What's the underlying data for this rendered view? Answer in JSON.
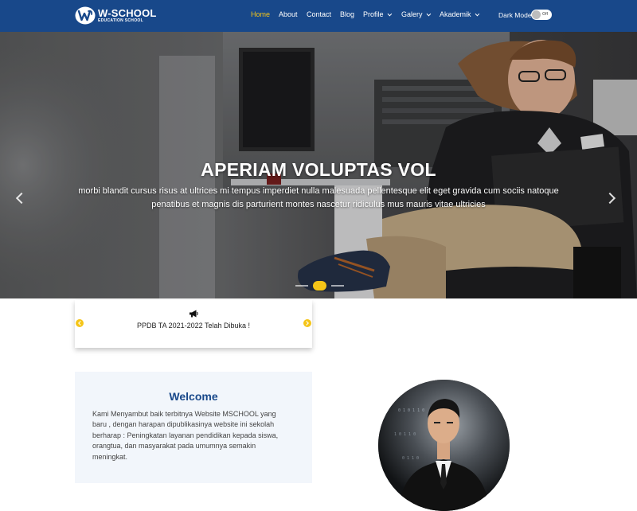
{
  "brand": {
    "name": "W-SCHOOL",
    "subtitle": "EDUCATION SCHOOL",
    "logo_letter": "W"
  },
  "nav": {
    "items": [
      {
        "label": "Home",
        "active": true
      },
      {
        "label": "About"
      },
      {
        "label": "Contact"
      },
      {
        "label": "Blog"
      },
      {
        "label": "Profile",
        "dropdown": true
      },
      {
        "label": "Galery",
        "dropdown": true
      },
      {
        "label": "Akademik",
        "dropdown": true
      }
    ],
    "dark_mode_label": "Dark Mode",
    "dark_mode_toggle_state": "Off"
  },
  "hero": {
    "title": "APERIAM VOLUPTAS VOL",
    "description": "morbi blandit cursus risus at ultrices mi tempus imperdiet nulla malesuada pellentesque elit eget gravida cum sociis natoque penatibus et magnis dis parturient montes nascetur ridiculus mus mauris vitae ultricies",
    "slide_count": 3,
    "active_slide": 2
  },
  "announcement": {
    "icon": "megaphone-icon",
    "text": "PPDB TA 2021-2022 Telah Dibuka !"
  },
  "welcome": {
    "title": "Welcome",
    "text": "Kami Menyambut baik terbitnya Website MSCHOOL yang baru , dengan harapan dipublikasinya website ini sekolah berharap : Peningkatan layanan pendidikan kepada siswa, orangtua, dan masyarakat pada umumnya semakin meningkat."
  },
  "colors": {
    "navbar": "#18488a",
    "accent": "#f5c518",
    "welcome_bg": "#f2f6fb",
    "welcome_title": "#18488a"
  }
}
